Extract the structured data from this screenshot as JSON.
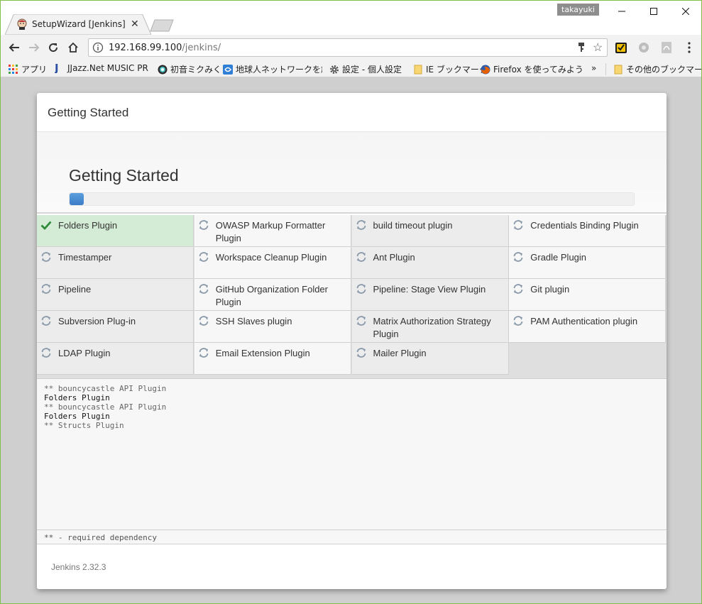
{
  "browser": {
    "profile_name": "takayuki",
    "tab": {
      "title": "SetupWizard [Jenkins]"
    },
    "url": {
      "host": "192.168.99.100",
      "path": "/jenkins/"
    },
    "bookmarks": [
      {
        "label": "アプリ",
        "icon": "apps-grid-icon"
      },
      {
        "label": "JJazz.Net MUSIC PRO",
        "icon": "jjazz-icon"
      },
      {
        "label": "初音ミクみく",
        "icon": "miku-icon"
      },
      {
        "label": "地球人ネットワークを創る",
        "icon": "earth-net-icon"
      },
      {
        "label": "設定 - 個人設定",
        "icon": "gear-icon"
      },
      {
        "label": "IE ブックマーク",
        "icon": "folder-icon"
      },
      {
        "label": "Firefox を使ってみよう",
        "icon": "firefox-icon"
      }
    ],
    "more_bookmarks": "»",
    "other_bookmarks": "その他のブックマーク"
  },
  "dialog": {
    "header_title": "Getting Started",
    "banner_title": "Getting Started",
    "progress_fraction": 0.025,
    "plugins": [
      {
        "name": "Folders Plugin",
        "status": "done"
      },
      {
        "name": "OWASP Markup Formatter Plugin",
        "status": "pending"
      },
      {
        "name": "build timeout plugin",
        "status": "pending"
      },
      {
        "name": "Credentials Binding Plugin",
        "status": "pending"
      },
      {
        "name": "Timestamper",
        "status": "pending"
      },
      {
        "name": "Workspace Cleanup Plugin",
        "status": "pending"
      },
      {
        "name": "Ant Plugin",
        "status": "pending"
      },
      {
        "name": "Gradle Plugin",
        "status": "pending"
      },
      {
        "name": "Pipeline",
        "status": "pending"
      },
      {
        "name": "GitHub Organization Folder Plugin",
        "status": "pending"
      },
      {
        "name": "Pipeline: Stage View Plugin",
        "status": "pending"
      },
      {
        "name": "Git plugin",
        "status": "pending"
      },
      {
        "name": "Subversion Plug-in",
        "status": "pending"
      },
      {
        "name": "SSH Slaves plugin",
        "status": "pending"
      },
      {
        "name": "Matrix Authorization Strategy Plugin",
        "status": "pending"
      },
      {
        "name": "PAM Authentication plugin",
        "status": "pending"
      },
      {
        "name": "LDAP Plugin",
        "status": "pending"
      },
      {
        "name": "Email Extension Plugin",
        "status": "pending"
      },
      {
        "name": "Mailer Plugin",
        "status": "pending"
      }
    ],
    "log_lines": [
      {
        "text": "** bouncycastle API Plugin",
        "kind": "dep"
      },
      {
        "text": "Folders Plugin",
        "kind": "main"
      },
      {
        "text": "** bouncycastle API Plugin",
        "kind": "dep"
      },
      {
        "text": "Folders Plugin",
        "kind": "main"
      },
      {
        "text": "** Structs Plugin",
        "kind": "dep"
      }
    ],
    "legend": "** - required dependency",
    "version": "Jenkins 2.32.3"
  },
  "colors": {
    "done_bg": "#d4ecd6",
    "check_green": "#2e8b3a",
    "progress_blue": "#3b7cc6",
    "spinner_gray": "#8a9aaa"
  }
}
